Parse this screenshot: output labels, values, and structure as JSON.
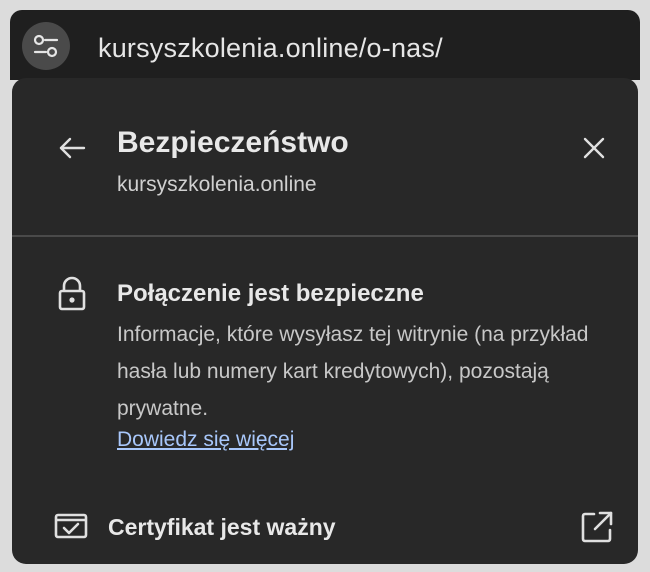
{
  "address_bar": {
    "domain": "kursyszkolenia.online",
    "path": "/o-nas/"
  },
  "header": {
    "title": "Bezpieczeństwo",
    "subtitle": "kursyszkolenia.online"
  },
  "connection": {
    "title": "Połączenie jest bezpieczne",
    "description": "Informacje, które wysyłasz tej witrynie (na przykład hasła lub numery kart kredytowych), pozostają prywatne.",
    "learn_more": "Dowiedz się więcej"
  },
  "certificate": {
    "label": "Certyfikat jest ważny"
  },
  "icons": {
    "site_info": "tune-icon",
    "back": "arrow-left-icon",
    "close": "close-icon",
    "lock": "lock-icon",
    "certificate": "certificate-icon",
    "open_external": "open-in-new-icon"
  },
  "colors": {
    "link": "#a8c7fa",
    "panel_bg": "#282828",
    "toolbar_bg": "#1f1f1f"
  }
}
